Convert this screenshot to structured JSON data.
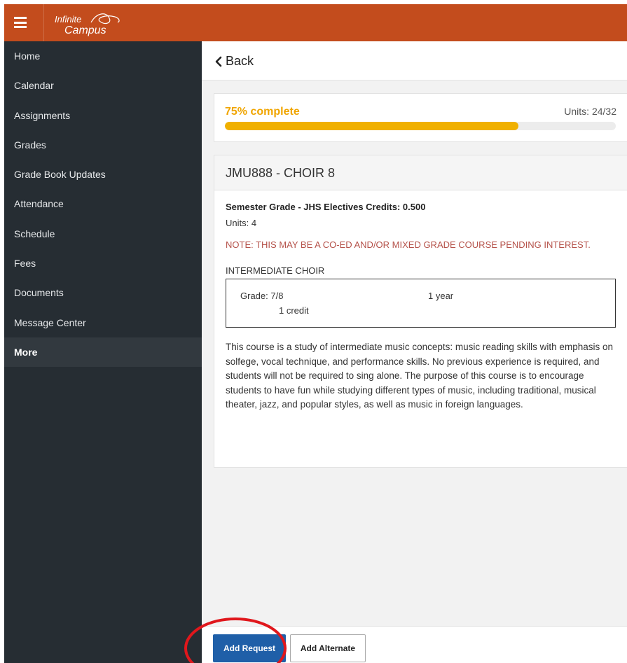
{
  "header": {
    "menu_icon": "hamburger-menu-icon",
    "logo_line1": "Infinite",
    "logo_line2": "Campus",
    "brand_color": "#c34c1d"
  },
  "sidebar": {
    "items": [
      {
        "label": "Home"
      },
      {
        "label": "Calendar"
      },
      {
        "label": "Assignments"
      },
      {
        "label": "Grades"
      },
      {
        "label": "Grade Book Updates"
      },
      {
        "label": "Attendance"
      },
      {
        "label": "Schedule"
      },
      {
        "label": "Fees"
      },
      {
        "label": "Documents"
      },
      {
        "label": "Message Center"
      },
      {
        "label": "More"
      }
    ],
    "active": "More"
  },
  "back": {
    "label": "Back",
    "icon": "chevron-left-icon"
  },
  "progress": {
    "label": "75% complete",
    "percent": 75,
    "units_label": "Units: 24/32",
    "color": "#f0b000"
  },
  "course": {
    "title": "JMU888 - CHOIR 8",
    "grade_line": "Semester Grade - JHS Electives Credits: 0.500",
    "units": "Units: 4",
    "note": "NOTE: THIS MAY BE A CO-ED AND/OR MIXED GRADE COURSE PENDING INTEREST.",
    "subheading": "INTERMEDIATE CHOIR",
    "info": {
      "grade": "Grade: 7/8",
      "duration": "1 year",
      "credit": "1 credit"
    },
    "description": "This course is a study of intermediate music concepts: music reading skills with emphasis on solfege, vocal technique, and performance skills.  No previous experience is required, and students will not be required to sing alone.  The purpose of this course is to encourage students to have fun while studying different types of music, including traditional, musical theater, jazz, and popular styles, as well as music in foreign languages."
  },
  "footer": {
    "add_request": "Add Request",
    "add_alternate": "Add Alternate",
    "primary_color": "#1f5fa8"
  },
  "annotation": {
    "color": "#e0171c"
  }
}
